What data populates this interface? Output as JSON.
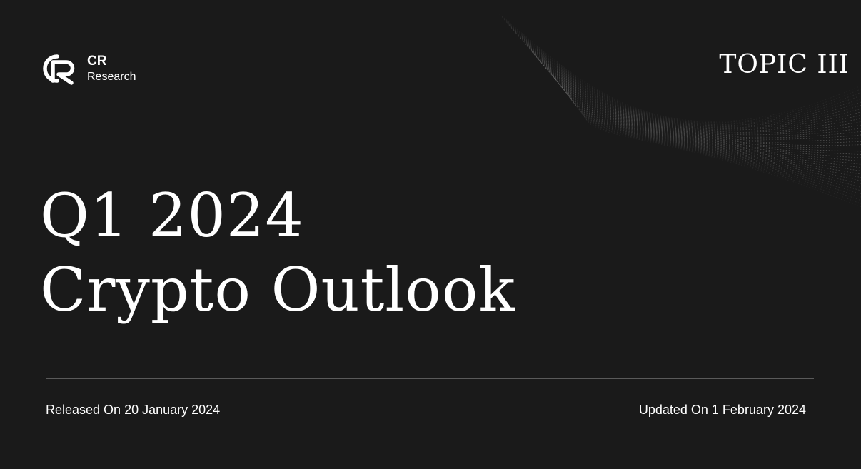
{
  "brand": {
    "name": "CR",
    "subtitle": "Research"
  },
  "topic": "TOPIC III",
  "title": {
    "line1": "Q1 2024",
    "line2": "Crypto Outlook"
  },
  "footer": {
    "released": "Released On 20 January 2024",
    "updated": "Updated On 1 February 2024"
  },
  "colors": {
    "background": "#1a1a1a",
    "text": "#ffffff",
    "divider": "#5a5a5a"
  }
}
